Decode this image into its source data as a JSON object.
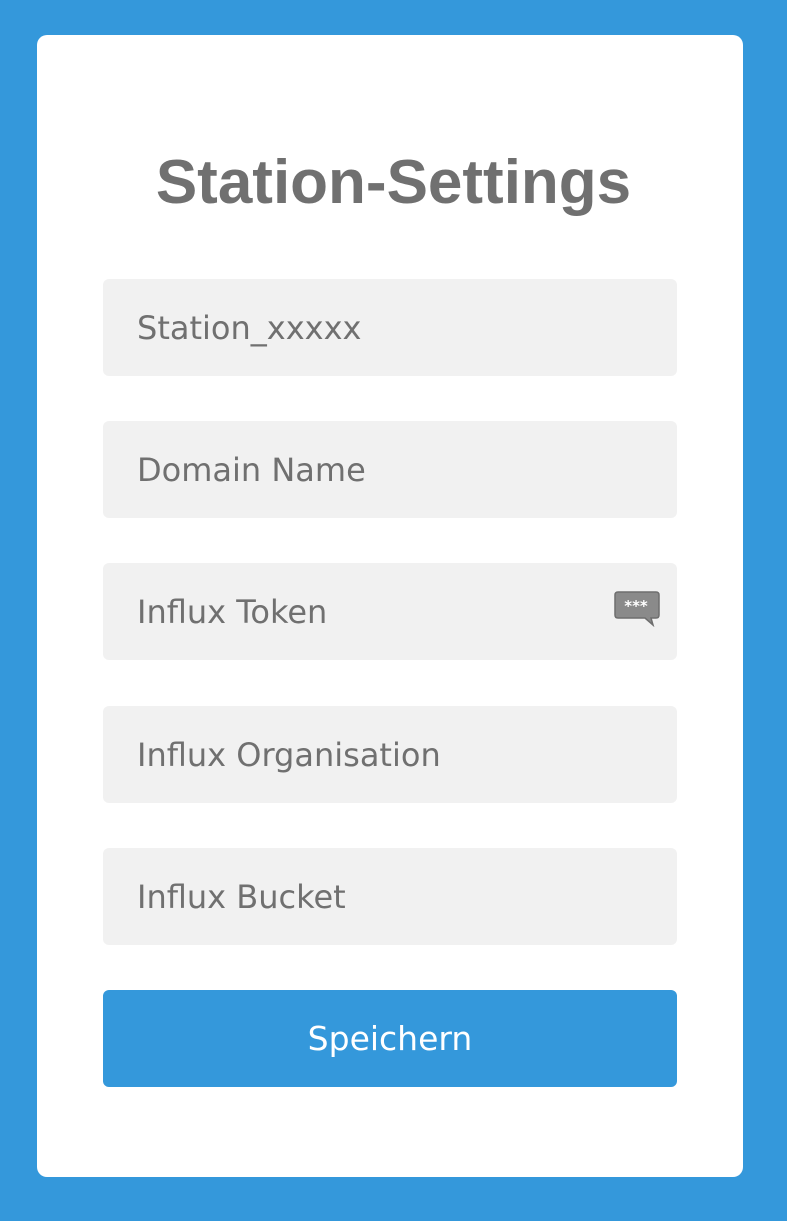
{
  "form": {
    "title": "Station-Settings",
    "fields": [
      {
        "placeholder": "Station_xxxxx",
        "value": ""
      },
      {
        "placeholder": "Domain Name",
        "value": ""
      },
      {
        "placeholder": "Influx Token",
        "value": ""
      },
      {
        "placeholder": "Influx Organisation",
        "value": ""
      },
      {
        "placeholder": "Influx Bucket",
        "value": ""
      }
    ],
    "password_icon": {
      "name": "password-manager-icon",
      "text": "***"
    },
    "save_label": "Speichern"
  },
  "colors": {
    "background": "#3498db",
    "card": "#ffffff",
    "field_background": "#f1f1f1",
    "text": "#707070",
    "button": "#3498db",
    "button_text": "#ffffff"
  }
}
